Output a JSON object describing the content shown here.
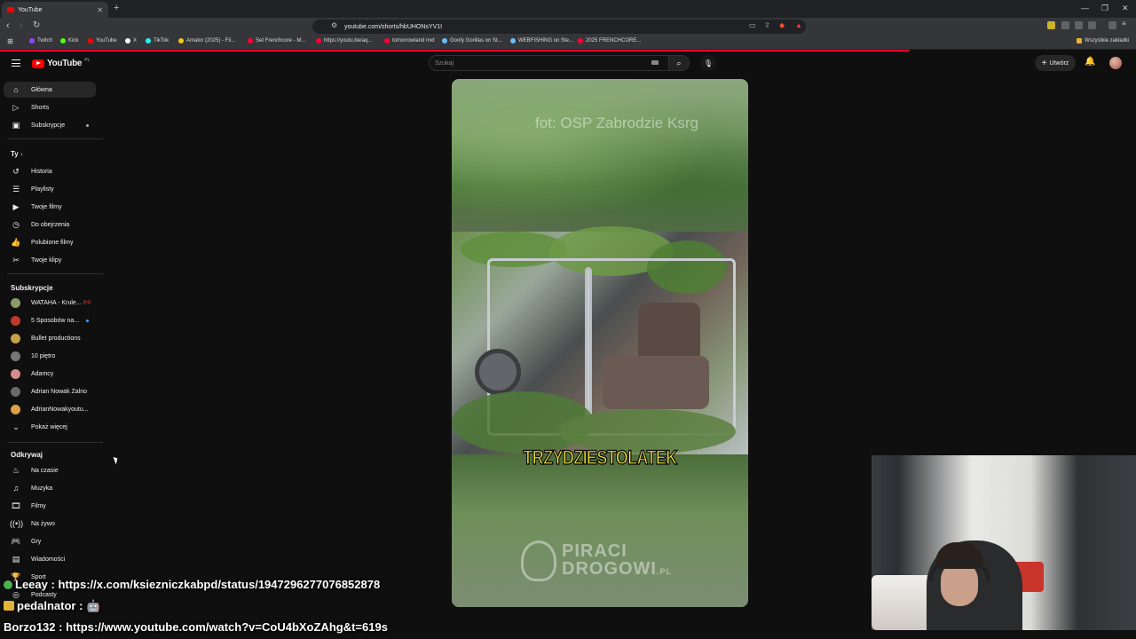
{
  "browser": {
    "tab_title": "YouTube",
    "url": "youtube.com/shorts/hbUHONsYV1I",
    "bookmarks": [
      {
        "label": "Twitch",
        "color": "#9146ff"
      },
      {
        "label": "Kick",
        "color": "#53fc18"
      },
      {
        "label": "YouTube",
        "color": "#ff0000"
      },
      {
        "label": "X",
        "color": "#ffffff"
      },
      {
        "label": "TikTok",
        "color": "#25f4ee"
      },
      {
        "label": "Amator (2025) - Fil...",
        "color": "#f5c518"
      },
      {
        "label": "Set Frenchcore - M...",
        "color": "#ff0033"
      },
      {
        "label": "https://youtu.be/aq...",
        "color": "#ff0033"
      },
      {
        "label": "tomorrowland mxt",
        "color": "#ff0033"
      },
      {
        "label": "Goofy Gorillas on St...",
        "color": "#66c0f4"
      },
      {
        "label": "WEBFISHING on Ste...",
        "color": "#66c0f4"
      },
      {
        "label": "2025 FRENCHCORE...",
        "color": "#ff0033"
      }
    ],
    "all_bookmarks": "Wszystkie zakładki"
  },
  "header": {
    "logo": "YouTube",
    "logo_region": "PL",
    "search_placeholder": "Szukaj",
    "create_label": "Utwórz"
  },
  "sidebar": {
    "main": [
      {
        "label": "Główna",
        "icon": "home-icon"
      },
      {
        "label": "Shorts",
        "icon": "shorts-icon"
      },
      {
        "label": "Subskrypcje",
        "icon": "subscriptions-icon"
      }
    ],
    "you_heading": "Ty",
    "you": [
      {
        "label": "Historia",
        "icon": "history-icon"
      },
      {
        "label": "Playlisty",
        "icon": "playlist-icon"
      },
      {
        "label": "Twoje filmy",
        "icon": "video-icon"
      },
      {
        "label": "Do obejrzenia",
        "icon": "clock-icon"
      },
      {
        "label": "Polubione filmy",
        "icon": "like-icon"
      },
      {
        "label": "Twoje klipy",
        "icon": "scissors-icon"
      }
    ],
    "subs_heading": "Subskrypcje",
    "subs": [
      {
        "label": "WATAHA - Krule...",
        "color": "#8a9a6a"
      },
      {
        "label": "5 Sposobów na...",
        "color": "#c0392b"
      },
      {
        "label": "Bullet productions",
        "color": "#c8a04a"
      },
      {
        "label": "10 piętro",
        "color": "#777777"
      },
      {
        "label": "Adamcy",
        "color": "#d88a8a"
      },
      {
        "label": "Adrian Nowak Zalno",
        "color": "#6a6a6a"
      },
      {
        "label": "AdrianNowakyoutu...",
        "color": "#e0a040"
      }
    ],
    "show_more": "Pokaż więcej",
    "explore_heading": "Odkrywaj",
    "explore": [
      {
        "label": "Na czasie",
        "icon": "trending-icon"
      },
      {
        "label": "Muzyka",
        "icon": "music-icon"
      },
      {
        "label": "Filmy",
        "icon": "film-icon"
      },
      {
        "label": "Na żywo",
        "icon": "live-icon"
      },
      {
        "label": "Gry",
        "icon": "gaming-icon"
      },
      {
        "label": "Wiadomości",
        "icon": "news-icon"
      },
      {
        "label": "Sport",
        "icon": "trophy-icon"
      },
      {
        "label": "Podcasty",
        "icon": "podcast-icon"
      }
    ]
  },
  "video": {
    "credit": "fot: OSP Zabrodzie Ksrg",
    "caption": "TRZYDZIESTOLATEK",
    "watermark_line1": "PIRACI",
    "watermark_line2": "DROGOWI",
    "watermark_suffix": ".PL"
  },
  "chat": [
    {
      "user": "Leeay",
      "text": ": https://x.com/ksiezniczkabpd/status/1947296277076852878"
    },
    {
      "user": "pedalnator",
      "text": ":"
    },
    {
      "user": "Borzo132",
      "text": ": https://www.youtube.com/watch?v=CoU4bXoZAhg&t=619s"
    }
  ]
}
